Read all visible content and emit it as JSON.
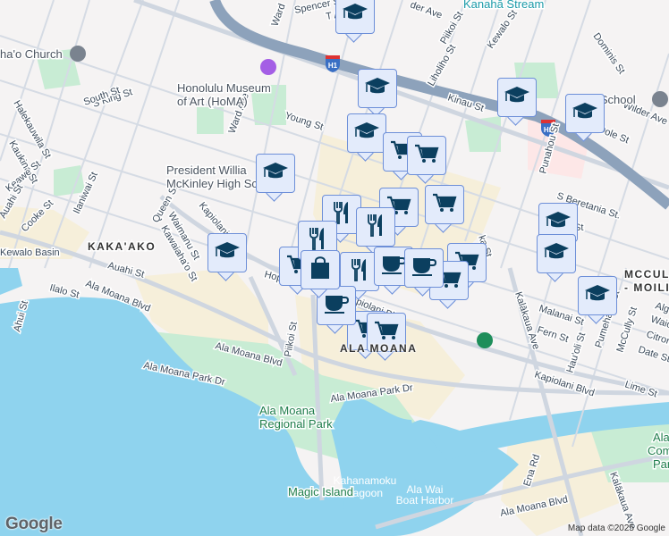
{
  "map": {
    "streets": {
      "spencer": "Spencer St",
      "ward_top": "Ward",
      "thurston": "T Ave",
      "wilder_top": "der Ave",
      "piikoi_top": "Piikoi St",
      "liholiho": "Liholiho St",
      "kewalo": "Kewalo St",
      "dominis": "Dominis St",
      "s_king": "S King St",
      "south": "South St",
      "young": "Young St",
      "kinau": "Kinau St",
      "wilder": "Wilder Ave",
      "dole": "Dole St",
      "halekauwila": "Halekauwila St",
      "kaukini": "Kaukina St",
      "keawe": "Keawe St",
      "auahi_l": "Auahi St",
      "cooke": "Cooke St",
      "ilaniwai": "Ilaniwai St",
      "ward_ave": "Ward Ave",
      "kapiolani_w": "Kapiolani Blvd",
      "waimanu": "Waimanu St",
      "kawaiahao": "Kawaiaha'o St",
      "queen": "Queen St",
      "auahi": "Auahi St",
      "ilalo": "Ilalo St",
      "ahui": "Ahui St",
      "ala_moana_w": "Ala Moana Blvd",
      "ala_moana_c": "Ala Moana Blvd",
      "hopaka": "Hopaka St",
      "piikoi": "Piikoi St",
      "kapiolani_c": "Kapiolani Blvd",
      "kona": "St",
      "ala_moana_park_dr1": "Ala Moana Park Dr",
      "ala_moana_park_dr2": "Ala Moana Park Dr",
      "kalakaua": "Kalākaua Ave",
      "mccully": "McCully St",
      "malanai": "Malanai St",
      "pumehana": "Pumehana St",
      "fern": "Fern St",
      "hauoli": "Hau'oli St",
      "citron": "Citron",
      "date": "Date St",
      "lime": "Lime St",
      "kapiolani_e": "Kapiolani Blvd",
      "beretania": "S Beretania St.",
      "punahou": "Punahou St",
      "ena": "Ena Rd",
      "ala_moana_e": "Ala Moana Blvd",
      "kalakaua_s": "Kalākaua Ave",
      "algaroba": "Alg",
      "waiola": "Waio",
      "st_small": "St",
      "keeaumoku": "ka St"
    },
    "places": {
      "church": "ha'o Church",
      "museum_1": "Honolulu Museum",
      "museum_2": "of Art (HoMA)",
      "school_1": "President Willia",
      "school_2": "McKinley High Scho",
      "punahou_school": "P     u School",
      "kakaako": "KAKA'AKO",
      "kewalo_basin": "Kewalo Basin",
      "ala_moana": "ALA MOANA",
      "mccully_1": "MCCULL",
      "mccully_2": "- MOILII",
      "park_1": "Ala Moana",
      "park_2": "Regional Park",
      "lagoon_1": "Kahanamoku",
      "lagoon_2": "Lagoon",
      "magic_island": "Magic Island",
      "harbor_1": "Ala Wai",
      "harbor_2": "Boat Harbor",
      "stream": "Kanahā Stream",
      "community_1": "Ala Wa",
      "community_2": "Commu",
      "community_3": "Park"
    },
    "shield": "H1",
    "markers": [
      "graduation-cap",
      "graduation-cap",
      "graduation-cap",
      "graduation-cap",
      "graduation-cap",
      "graduation-cap",
      "graduation-cap",
      "graduation-cap",
      "graduation-cap",
      "graduation-cap",
      "shopping-cart",
      "shopping-cart",
      "shopping-cart",
      "shopping-cart",
      "shopping-cart",
      "shopping-cart",
      "shopping-cart",
      "shopping-cart",
      "shopping-cart",
      "restaurant",
      "restaurant",
      "restaurant",
      "restaurant",
      "coffee",
      "coffee",
      "coffee",
      "shopping-bag"
    ],
    "colors": {
      "water": "#8fd3ee",
      "park": "#c8ecd4",
      "marker_bg": "#e3ebfb",
      "marker_icon": "#0b3f5f",
      "highway": "#8da2bb"
    }
  },
  "footer": {
    "logo": "Google",
    "attribution": "Map data ©2025 Google"
  }
}
